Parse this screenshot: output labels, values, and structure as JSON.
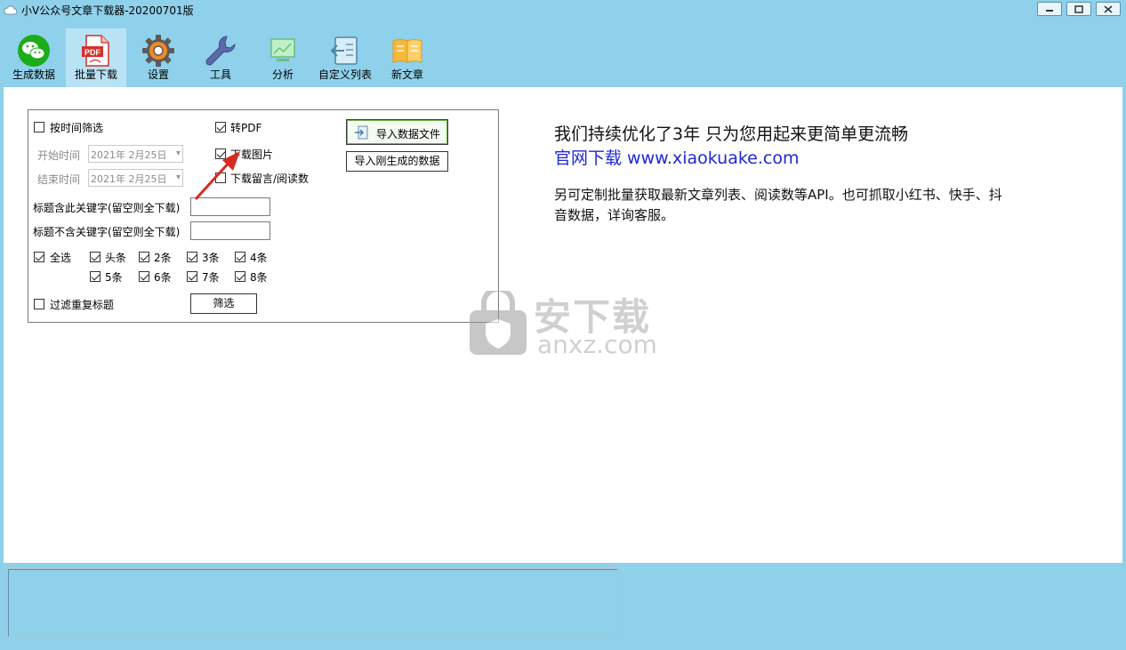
{
  "window": {
    "title": "小V公众号文章下载器-20200701版",
    "controls": [
      "minimize",
      "maximize",
      "close"
    ]
  },
  "toolbar": {
    "items": [
      {
        "label": "生成数据",
        "icon": "wechat-icon"
      },
      {
        "label": "批量下载",
        "icon": "pdf-icon",
        "active": true
      },
      {
        "label": "设置",
        "icon": "gear-icon"
      },
      {
        "label": "工具",
        "icon": "wrench-icon"
      },
      {
        "label": "分析",
        "icon": "chart-icon"
      },
      {
        "label": "自定义列表",
        "icon": "list-import-icon"
      },
      {
        "label": "新文章",
        "icon": "book-icon"
      }
    ]
  },
  "filters": {
    "time_filter": {
      "label": "按时间筛选",
      "checked": false
    },
    "start_time": {
      "label": "开始时间",
      "value": "2021年 2月25日"
    },
    "end_time": {
      "label": "结束时间",
      "value": "2021年 2月25日"
    },
    "include_keyword": {
      "label": "标题含此关键字(留空则全下载)",
      "value": ""
    },
    "exclude_keyword": {
      "label": "标题不含关键字(留空则全下载)",
      "value": ""
    },
    "select_all": {
      "label": "全选",
      "checked": true
    },
    "positions": [
      {
        "label": "头条",
        "checked": true
      },
      {
        "label": "2条",
        "checked": true
      },
      {
        "label": "3条",
        "checked": true
      },
      {
        "label": "4条",
        "checked": true
      },
      {
        "label": "5条",
        "checked": true
      },
      {
        "label": "6条",
        "checked": true
      },
      {
        "label": "7条",
        "checked": true
      },
      {
        "label": "8条",
        "checked": true
      }
    ],
    "dedupe": {
      "label": "过滤重复标题",
      "checked": false
    },
    "filter_button": "筛选"
  },
  "options": {
    "to_pdf": {
      "label": "转PDF",
      "checked": true
    },
    "download_images": {
      "label": "下载图片",
      "checked": true
    },
    "download_comments": {
      "label": "下载留言/阅读数",
      "checked": false
    }
  },
  "actions": {
    "import_file": "导入数据文件",
    "import_generated": "导入刚生成的数据"
  },
  "promo": {
    "line1": "我们持续优化了3年 只为您用起来更简单更流畅",
    "line2": "官网下载 www.xiaokuake.com",
    "line3": "另可定制批量获取最新文章列表、阅读数等API。也可抓取小红书、快手、抖音数据，详询客服。"
  },
  "watermark": {
    "text1": "安下载",
    "text2": "anxz.com"
  },
  "colors": {
    "chrome": "#8fd0ea",
    "link": "#1f27d6",
    "arrow": "#d62b22"
  }
}
